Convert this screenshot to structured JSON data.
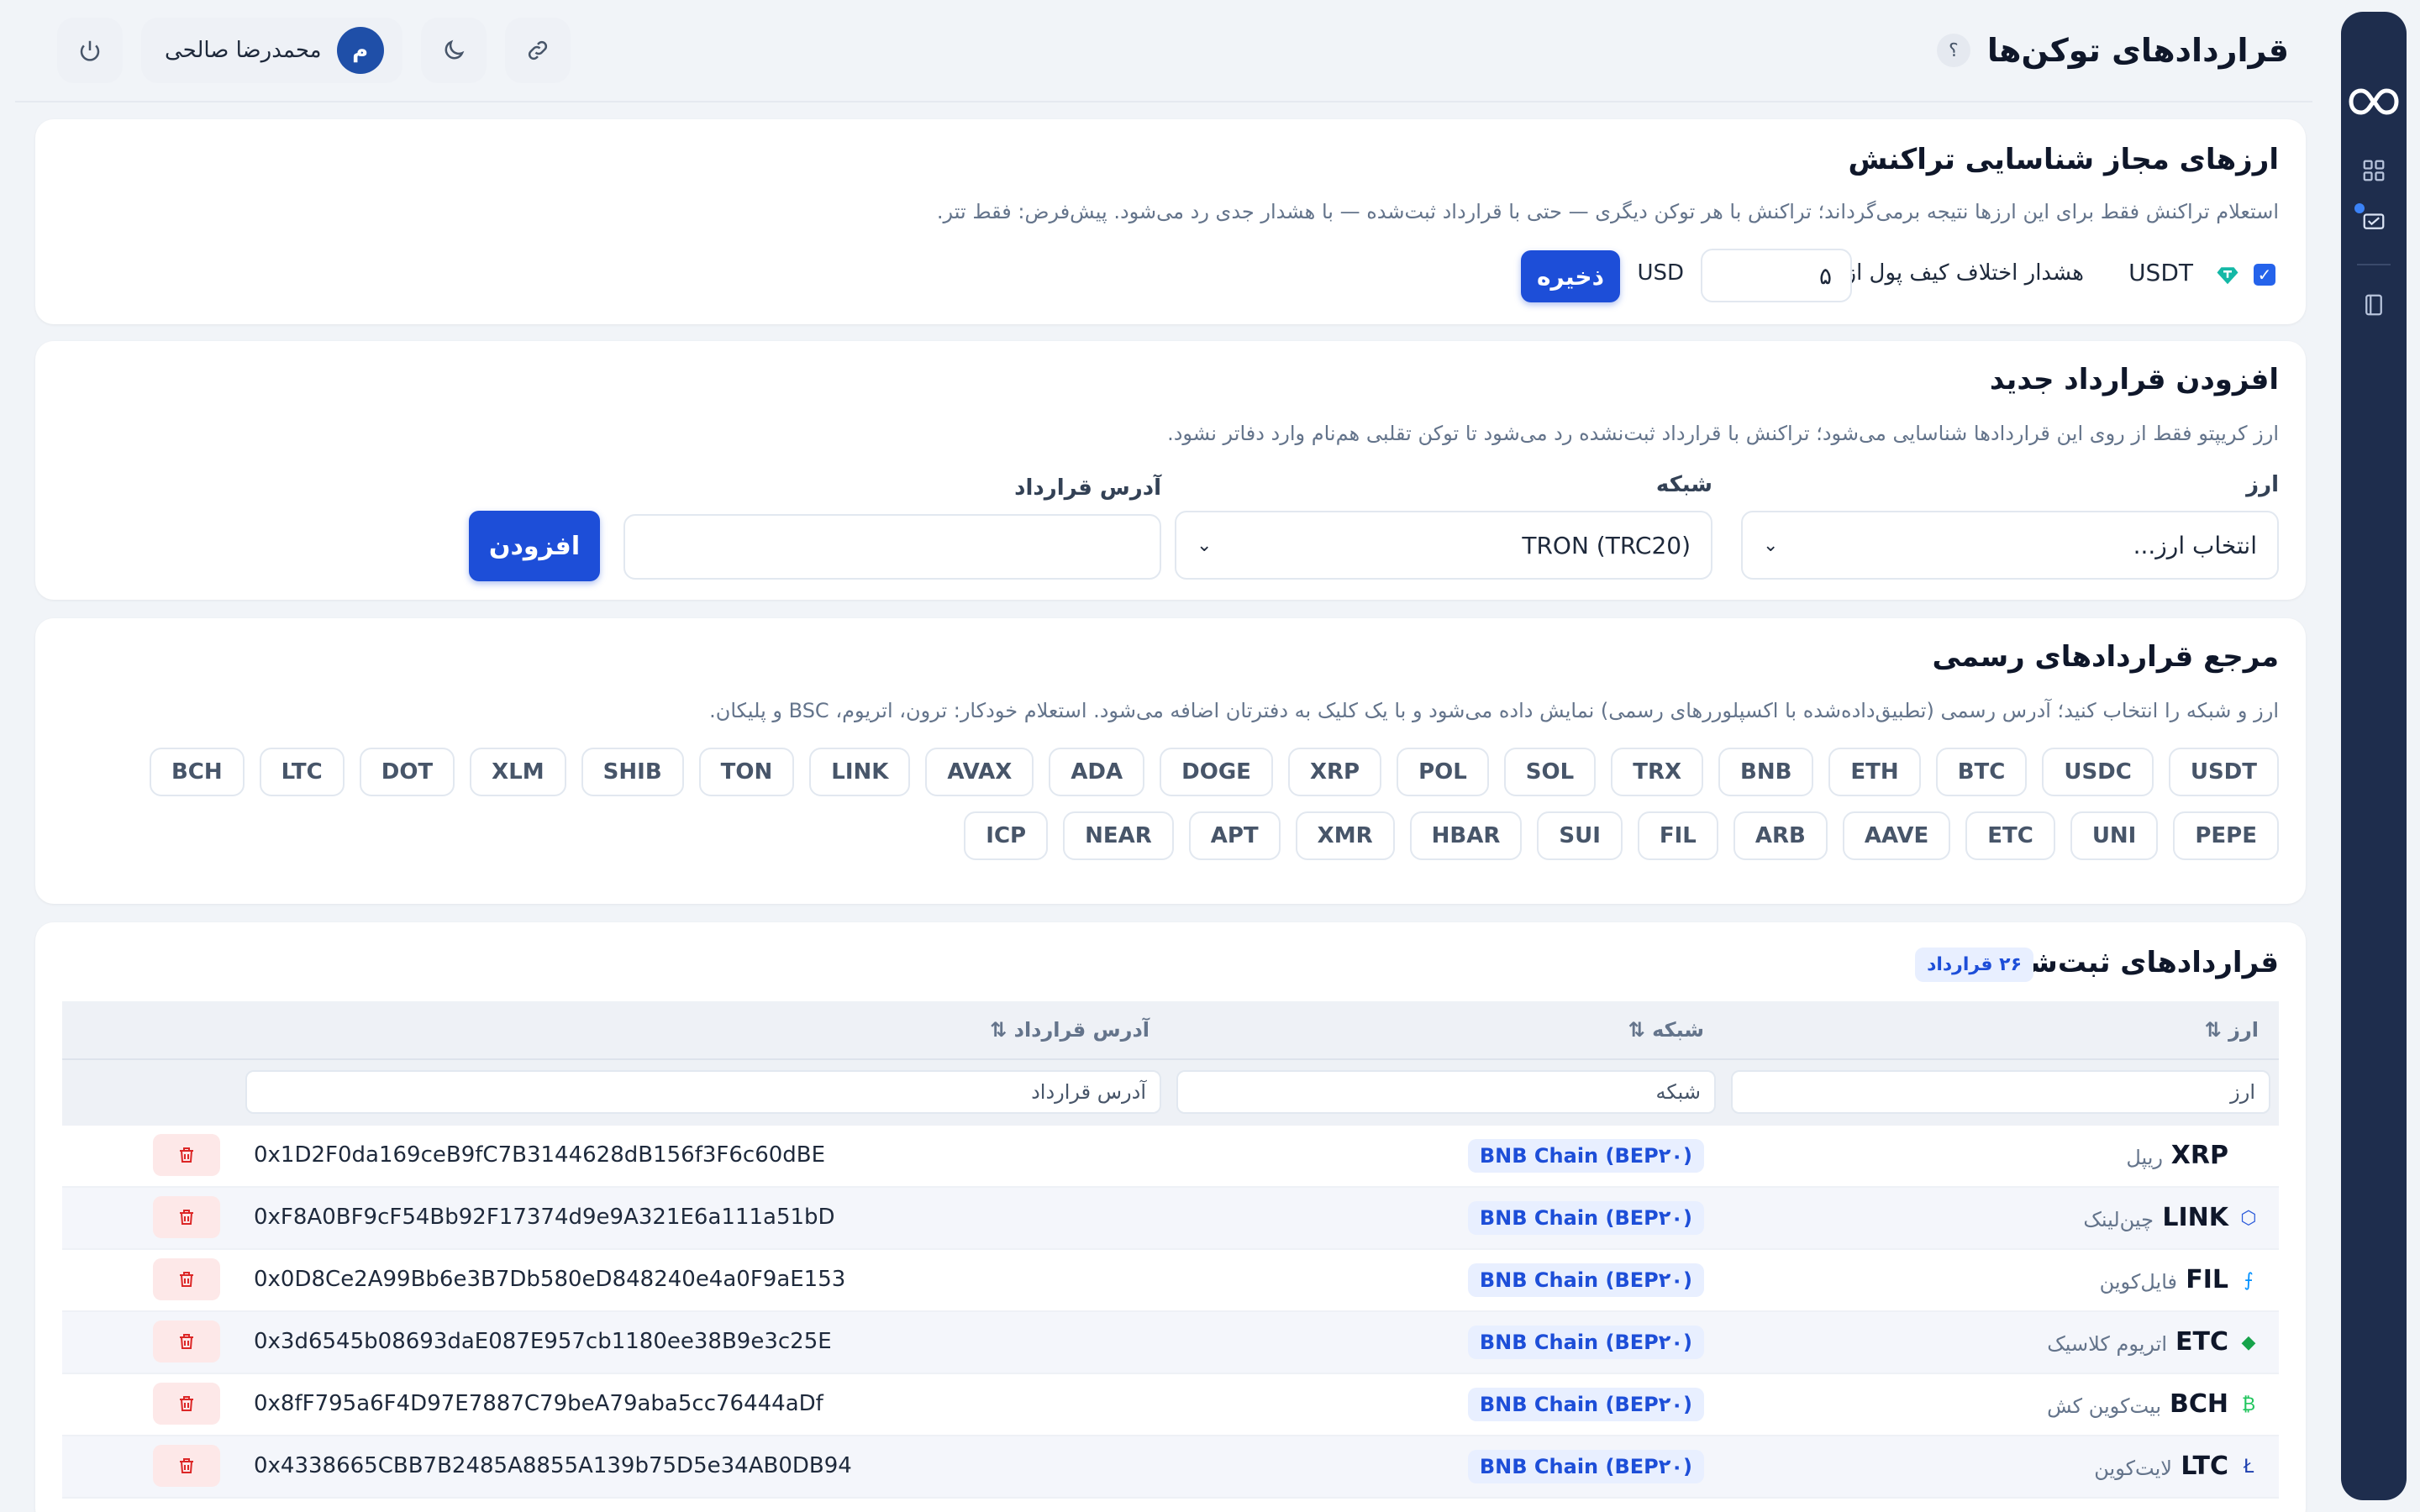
{
  "header": {
    "title": "قراردادهای توکن‌ها",
    "help": "؟",
    "user_initial": "م",
    "user_name": "محمدرضا صالحی"
  },
  "allowed": {
    "title": "ارزهای مجاز شناسایی تراکنش",
    "desc": "استعلام تراکنش فقط برای این ارزها نتیجه برمی‌گرداند؛ تراکنش با هر توکن دیگری — حتی با قرارداد ثبت‌شده — با هشدار جدی رد می‌شود. پیش‌فرض: فقط تتر.",
    "currency": "USDT",
    "checked": true,
    "warn_label": "هشدار اختلاف کیف پول از",
    "warn_value": "۵",
    "unit": "USD",
    "save_label": "ذخیره"
  },
  "add": {
    "title": "افزودن قرارداد جدید",
    "desc": "ارز کریپتو فقط از روی این قراردادها شناسایی می‌شود؛ تراکنش با قرارداد ثبت‌نشده رد می‌شود تا توکن تقلبی هم‌نام وارد دفاتر نشود.",
    "currency_label": "ارز",
    "currency_value": "انتخاب ارز...",
    "network_label": "شبکه",
    "network_value": "TRON (TRC20)",
    "address_label": "آدرس قرارداد",
    "address_value": "",
    "add_label": "افزودن"
  },
  "reference": {
    "title": "مرجع قراردادهای رسمی",
    "desc": "ارز و شبکه را انتخاب کنید؛ آدرس رسمی (تطبیق‌داده‌شده با اکسپلوررهای رسمی) نمایش داده می‌شود و با یک کلیک به دفترتان اضافه می‌شود. استعلام خودکار: ترون، اتریوم، BSC و پلیکان.",
    "chips": [
      "USDT",
      "USDC",
      "BTC",
      "ETH",
      "BNB",
      "TRX",
      "SOL",
      "POL",
      "XRP",
      "DOGE",
      "ADA",
      "AVAX",
      "LINK",
      "TON",
      "SHIB",
      "XLM",
      "DOT",
      "LTC",
      "BCH",
      "PEPE",
      "UNI",
      "ETC",
      "AAVE",
      "ARB",
      "FIL",
      "SUI",
      "HBAR",
      "XMR",
      "APT",
      "NEAR",
      "ICP"
    ]
  },
  "registered": {
    "title": "قراردادهای ثبت‌شده",
    "count": "۲۶ قرارداد",
    "col_currency": "ارز ⇅",
    "col_network": "شبکه ⇅",
    "col_address": "آدرس قرارداد ⇅",
    "filter_currency": "ارز",
    "filter_network": "شبکه",
    "filter_address": "آدرس قرارداد",
    "rows": [
      {
        "symbol": "XRP",
        "name": "ریپل",
        "icon": "",
        "icon_color": "#0f172a",
        "network": "BNB Chain (BEP۲۰)",
        "address": "0x1D2F0da169ceB9fC7B3144628dB156f3F6c60dBE"
      },
      {
        "symbol": "LINK",
        "name": "چین‌لینک",
        "icon": "⬡",
        "icon_color": "#2a5ada",
        "network": "BNB Chain (BEP۲۰)",
        "address": "0xF8A0BF9cF54Bb92F17374d9e9A321E6a111a51bD"
      },
      {
        "symbol": "FIL",
        "name": "فایل‌کوین",
        "icon": "⨍",
        "icon_color": "#0090ff",
        "network": "BNB Chain (BEP۲۰)",
        "address": "0x0D8Ce2A99Bb6e3B7Db580eD848240e4a0F9aE153"
      },
      {
        "symbol": "ETC",
        "name": "اتریوم کلاسیک",
        "icon": "◆",
        "icon_color": "#16a34a",
        "network": "BNB Chain (BEP۲۰)",
        "address": "0x3d6545b08693daE087E957cb1180ee38B9e3c25E"
      },
      {
        "symbol": "BCH",
        "name": "بیت‌کوین کش",
        "icon": "₿",
        "icon_color": "#22c55e",
        "network": "BNB Chain (BEP۲۰)",
        "address": "0x8fF795a6F4D97E7887C79beA79aba5cc76444aDf"
      },
      {
        "symbol": "LTC",
        "name": "لایت‌کوین",
        "icon": "Ł",
        "icon_color": "#1e40af",
        "network": "BNB Chain (BEP۲۰)",
        "address": "0x4338665CBB7B2485A8855A139b75D5e34AB0DB94"
      }
    ]
  }
}
